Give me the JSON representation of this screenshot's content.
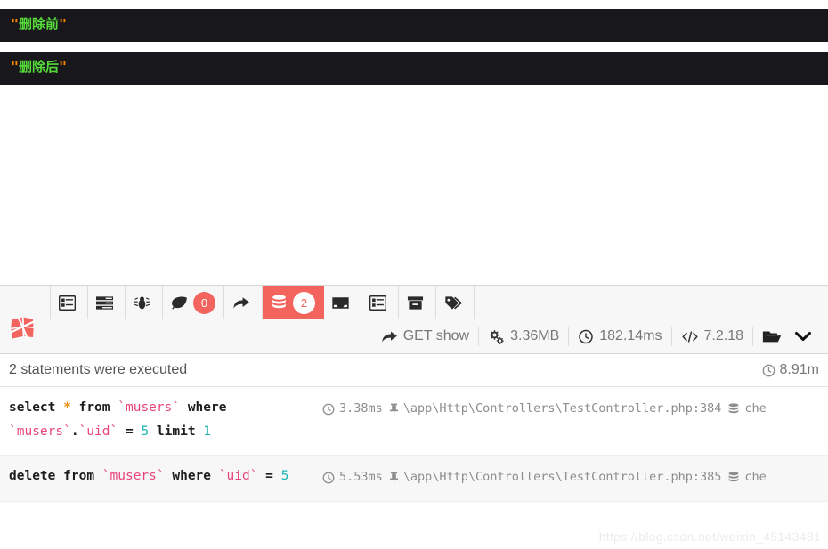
{
  "dumps": [
    {
      "name": "dump-before-delete",
      "quote": "\"",
      "text": "删除前"
    },
    {
      "name": "dump-after-delete",
      "quote": "\"",
      "text": "删除后"
    }
  ],
  "debugbar": {
    "logo_name": "laravel-logo-icon",
    "tabs": [
      {
        "id": "messages",
        "icon": "list-alt-icon",
        "label": "",
        "badge": "",
        "active": false
      },
      {
        "id": "timeline",
        "icon": "tasks-icon",
        "label": "",
        "badge": "",
        "active": false
      },
      {
        "id": "exceptions",
        "icon": "bug-icon",
        "label": "",
        "badge": "",
        "active": false
      },
      {
        "id": "views",
        "icon": "leaf-icon",
        "label": "",
        "badge": "0",
        "active": false
      },
      {
        "id": "route",
        "icon": "share-icon",
        "label": "",
        "badge": "",
        "active": false
      },
      {
        "id": "queries",
        "icon": "database-icon",
        "label": "",
        "badge": "2",
        "active": true
      },
      {
        "id": "mails",
        "icon": "inbox-icon",
        "label": "",
        "badge": "",
        "active": false
      },
      {
        "id": "session",
        "icon": "list-alt-icon",
        "label": "",
        "badge": "",
        "active": false
      },
      {
        "id": "request",
        "icon": "archive-icon",
        "label": "",
        "badge": "",
        "active": false
      },
      {
        "id": "auth",
        "icon": "tags-icon",
        "label": "",
        "badge": "",
        "active": false
      }
    ],
    "status": [
      {
        "id": "route",
        "icon": "share-icon",
        "value": "GET show"
      },
      {
        "id": "memory",
        "icon": "gears-icon",
        "value": "3.36MB"
      },
      {
        "id": "time",
        "icon": "clock-icon",
        "value": "182.14ms"
      },
      {
        "id": "php",
        "icon": "code-icon",
        "value": "7.2.18"
      }
    ],
    "open_icon": "folder-open-icon",
    "minimize_icon": "chevron-down-icon",
    "accent_color": "#f4645f",
    "panel": {
      "summary": "2 statements were executed",
      "total_time_icon": "clock-icon",
      "total_time": "8.91m",
      "rows": [
        {
          "sql_tokens": [
            {
              "t": "kw",
              "v": "select"
            },
            {
              "t": "sp",
              "v": " "
            },
            {
              "t": "star",
              "v": "*"
            },
            {
              "t": "sp",
              "v": " "
            },
            {
              "t": "kw",
              "v": "from"
            },
            {
              "t": "sp",
              "v": " "
            },
            {
              "t": "ident",
              "v": "`musers`"
            },
            {
              "t": "sp",
              "v": " "
            },
            {
              "t": "kw",
              "v": "where"
            },
            {
              "t": "sp",
              "v": " "
            },
            {
              "t": "ident",
              "v": "`musers`"
            },
            {
              "t": "op",
              "v": "."
            },
            {
              "t": "ident",
              "v": "`uid`"
            },
            {
              "t": "sp",
              "v": " "
            },
            {
              "t": "op",
              "v": "="
            },
            {
              "t": "sp",
              "v": " "
            },
            {
              "t": "num",
              "v": "5"
            },
            {
              "t": "sp",
              "v": " "
            },
            {
              "t": "kw",
              "v": "limit"
            },
            {
              "t": "sp",
              "v": " "
            },
            {
              "t": "num",
              "v": "1"
            }
          ],
          "duration_icon": "clock-icon",
          "duration": "3.38ms",
          "file_icon": "thumb-tack-icon",
          "file": "\\app\\Http\\Controllers\\TestController.php:384",
          "db_icon": "database-icon",
          "connection": "che"
        },
        {
          "sql_tokens": [
            {
              "t": "kw",
              "v": "delete"
            },
            {
              "t": "sp",
              "v": " "
            },
            {
              "t": "kw",
              "v": "from"
            },
            {
              "t": "sp",
              "v": " "
            },
            {
              "t": "ident",
              "v": "`musers`"
            },
            {
              "t": "sp",
              "v": " "
            },
            {
              "t": "kw",
              "v": "where"
            },
            {
              "t": "sp",
              "v": " "
            },
            {
              "t": "ident",
              "v": "`uid`"
            },
            {
              "t": "sp",
              "v": " "
            },
            {
              "t": "op",
              "v": "="
            },
            {
              "t": "sp",
              "v": " "
            },
            {
              "t": "num",
              "v": "5"
            }
          ],
          "duration_icon": "clock-icon",
          "duration": "5.53ms",
          "file_icon": "thumb-tack-icon",
          "file": "\\app\\Http\\Controllers\\TestController.php:385",
          "db_icon": "database-icon",
          "connection": "che"
        }
      ]
    }
  },
  "watermark": "https://blog.csdn.net/weixin_45143481"
}
